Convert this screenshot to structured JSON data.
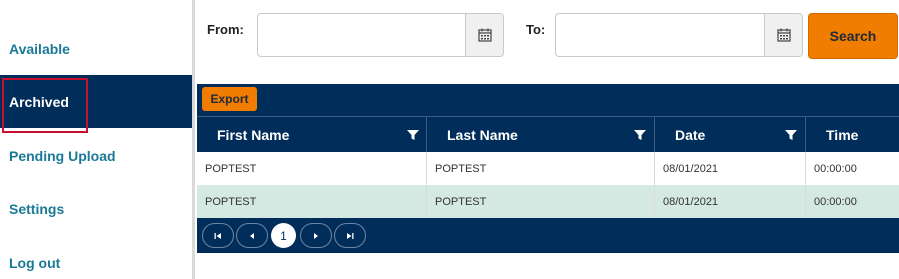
{
  "sidebar": {
    "items": [
      {
        "label": "Available"
      },
      {
        "label": "Archived"
      },
      {
        "label": "Pending Upload"
      },
      {
        "label": "Settings"
      },
      {
        "label": "Log out"
      }
    ]
  },
  "filters": {
    "from_label": "From:",
    "from_value": "",
    "to_label": "To:",
    "to_value": "",
    "search_label": "Search"
  },
  "grid": {
    "export_label": "Export",
    "columns": [
      "First Name",
      "Last Name",
      "Date",
      "Time"
    ],
    "rows": [
      [
        "POPTEST",
        "POPTEST",
        "08/01/2021",
        "00:00:00"
      ],
      [
        "POPTEST",
        "POPTEST",
        "08/01/2021",
        "00:00:00"
      ]
    ],
    "pager": {
      "current_page": "1"
    }
  },
  "colors": {
    "navy": "#002d5a",
    "accent_orange": "#f07c00",
    "link_teal": "#1a7a96",
    "row_alt": "#d4e9e2"
  },
  "icons": [
    "calendar-icon",
    "filter-icon",
    "first-page-icon",
    "prev-page-icon",
    "next-page-icon",
    "last-page-icon"
  ]
}
